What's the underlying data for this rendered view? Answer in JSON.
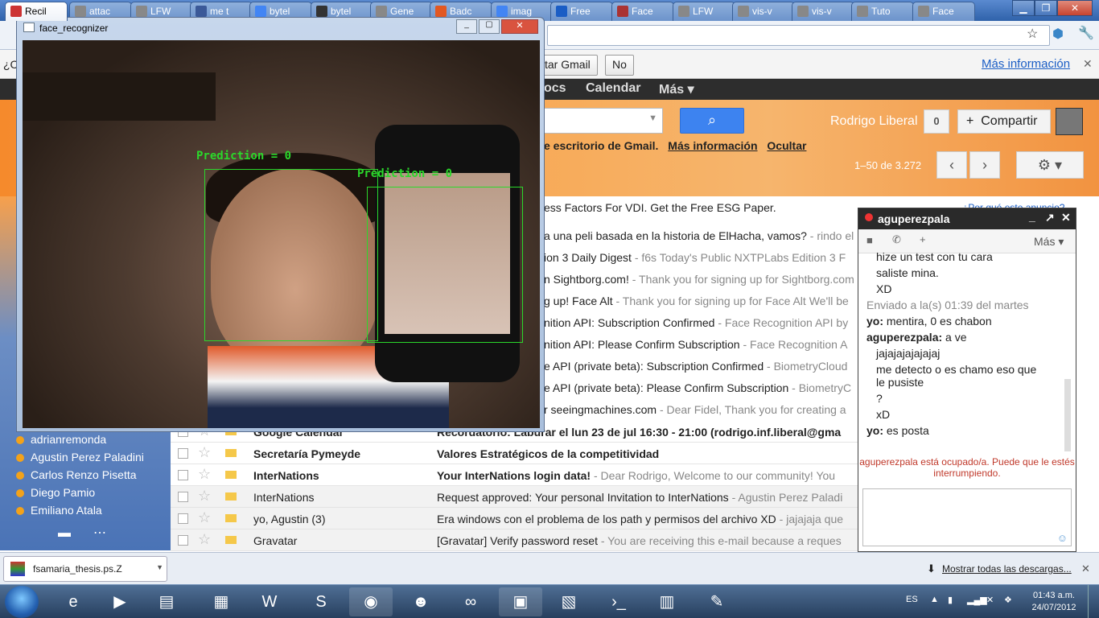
{
  "browser": {
    "tabs": [
      {
        "label": "Recil",
        "favicon_color": "#c33",
        "active": true
      },
      {
        "label": "attac",
        "favicon_color": "#888"
      },
      {
        "label": "LFW",
        "favicon_color": "#888"
      },
      {
        "label": "me t",
        "favicon_color": "#3b5998"
      },
      {
        "label": "bytel",
        "favicon_color": "#4285f4"
      },
      {
        "label": "bytel",
        "favicon_color": "#333"
      },
      {
        "label": "Gene",
        "favicon_color": "#888"
      },
      {
        "label": "Badc",
        "favicon_color": "#e25822"
      },
      {
        "label": "imag",
        "favicon_color": "#4285f4"
      },
      {
        "label": "Free",
        "favicon_color": "#1a5dc5"
      },
      {
        "label": "Face",
        "favicon_color": "#a33"
      },
      {
        "label": "LFW",
        "favicon_color": "#888"
      },
      {
        "label": "vis-v",
        "favicon_color": "#888"
      },
      {
        "label": "vis-v",
        "favicon_color": "#888"
      },
      {
        "label": "Tuto",
        "favicon_color": "#888"
      },
      {
        "label": "Face",
        "favicon_color": "#888"
      }
    ]
  },
  "infobar": {
    "question_prefix": "¿C",
    "button_fragment": "tar Gmail",
    "no_button": "No",
    "more_info": "Más información",
    "close": "✕"
  },
  "gmail_bar": {
    "items": [
      "ocs",
      "Calendar",
      "Más ▾"
    ]
  },
  "header": {
    "user": "Rodrigo Liberal",
    "notif_count": "0",
    "share": "Compartir",
    "promo_text": "e escritorio de Gmail.",
    "promo_more": "Más información",
    "promo_hide": "Ocultar",
    "pager": "1–50 de 3.272"
  },
  "ad": {
    "text": "ess Factors For VDI. Get the Free ESG Paper.",
    "why": "¿Por qué este anuncio?"
  },
  "partial_rows": [
    {
      "subj": "a una peli basada en la historia de ElHacha, vamos?",
      "snip": " - rindo el"
    },
    {
      "subj": "ion 3 Daily Digest",
      "snip": " - f6s Today's Public NXTPLabs Edition 3 F"
    },
    {
      "subj": "n Sightborg.com!",
      "snip": " - Thank you for signing up for Sightborg.com"
    },
    {
      "subj": "g up! Face Alt",
      "snip": " - Thank you for signing up for Face Alt We'll be"
    },
    {
      "subj": "nition API: Subscription Confirmed",
      "snip": " - Face Recognition API by"
    },
    {
      "subj": "nition API: Please Confirm Subscription",
      "snip": " - Face Recognition A"
    },
    {
      "subj": "e API (private beta): Subscription Confirmed",
      "snip": " - BiometryCloud"
    },
    {
      "subj": "e API (private beta): Please Confirm Subscription",
      "snip": " - BiometryC"
    },
    {
      "subj": "r seeingmachines.com",
      "snip": " - Dear Fidel, Thank you for creating a"
    }
  ],
  "rows": [
    {
      "from": "Google Calendar",
      "subj": "Recordatorio: Laburar el lun 23 de jul 16:30 - 21:00 (rodrigo.inf.liberal@gma",
      "snip": "",
      "unread": true
    },
    {
      "from": "Secretaría Pymeyde",
      "subj": "Valores Estratégicos de la competitividad",
      "snip": "",
      "unread": true
    },
    {
      "from": "InterNations",
      "subj": "Your InterNations login data!",
      "snip": " - Dear Rodrigo, Welcome to our community! You",
      "unread": true
    },
    {
      "from": "InterNations",
      "subj": "Request approved: Your personal Invitation to InterNations",
      "snip": " - Agustin Perez Paladi",
      "unread": false
    },
    {
      "from": "yo, Agustin (3)",
      "subj": "Era windows con el problema de los path y permisos del archivo XD",
      "snip": " - jajajaja que",
      "unread": false
    },
    {
      "from": "Gravatar",
      "subj": "[Gravatar] Verify password reset",
      "snip": " - You are receiving this e-mail because a reques",
      "unread": false
    }
  ],
  "sidebar": {
    "contacts": [
      "adrianremonda",
      "Agustin Perez Paladini",
      "Carlos Renzo Pisetta",
      "Diego Pamio",
      "Emiliano Atala"
    ]
  },
  "chat": {
    "title": "aguperezpala",
    "more": "Más ▾",
    "lines": [
      {
        "text": "hize un test con tu cara",
        "style": "msg"
      },
      {
        "text": "saliste mina.",
        "style": "msg"
      },
      {
        "text": "XD",
        "style": "msg"
      },
      {
        "text": "Enviado a la(s) 01:39 del martes",
        "style": "meta"
      },
      {
        "text": "yo:  mentira, 0 es chabon",
        "style": "self"
      },
      {
        "text": "aguperezpala:  a ve",
        "style": "other"
      },
      {
        "text": "jajajajajajajaj",
        "style": "msg"
      },
      {
        "text": "me detecto o es chamo eso que",
        "style": "msg"
      },
      {
        "text": "le pusiste",
        "style": "msg"
      },
      {
        "text": "?",
        "style": "msg"
      },
      {
        "text": "xD",
        "style": "msg"
      },
      {
        "text": "yo:  es posta",
        "style": "self"
      }
    ],
    "status": "aguperezpala está ocupado/a. Puede que le estés interrumpiendo."
  },
  "cv_window": {
    "title": "face_recognizer",
    "labels": [
      "Prediction = 0",
      "Prediction = 0"
    ]
  },
  "downloads": {
    "file": "fsamaria_thesis.ps.Z",
    "show_all": "Mostrar todas las descargas..."
  },
  "taskbar": {
    "lang": "ES",
    "time": "01:43 a.m.",
    "date": "24/07/2012"
  }
}
